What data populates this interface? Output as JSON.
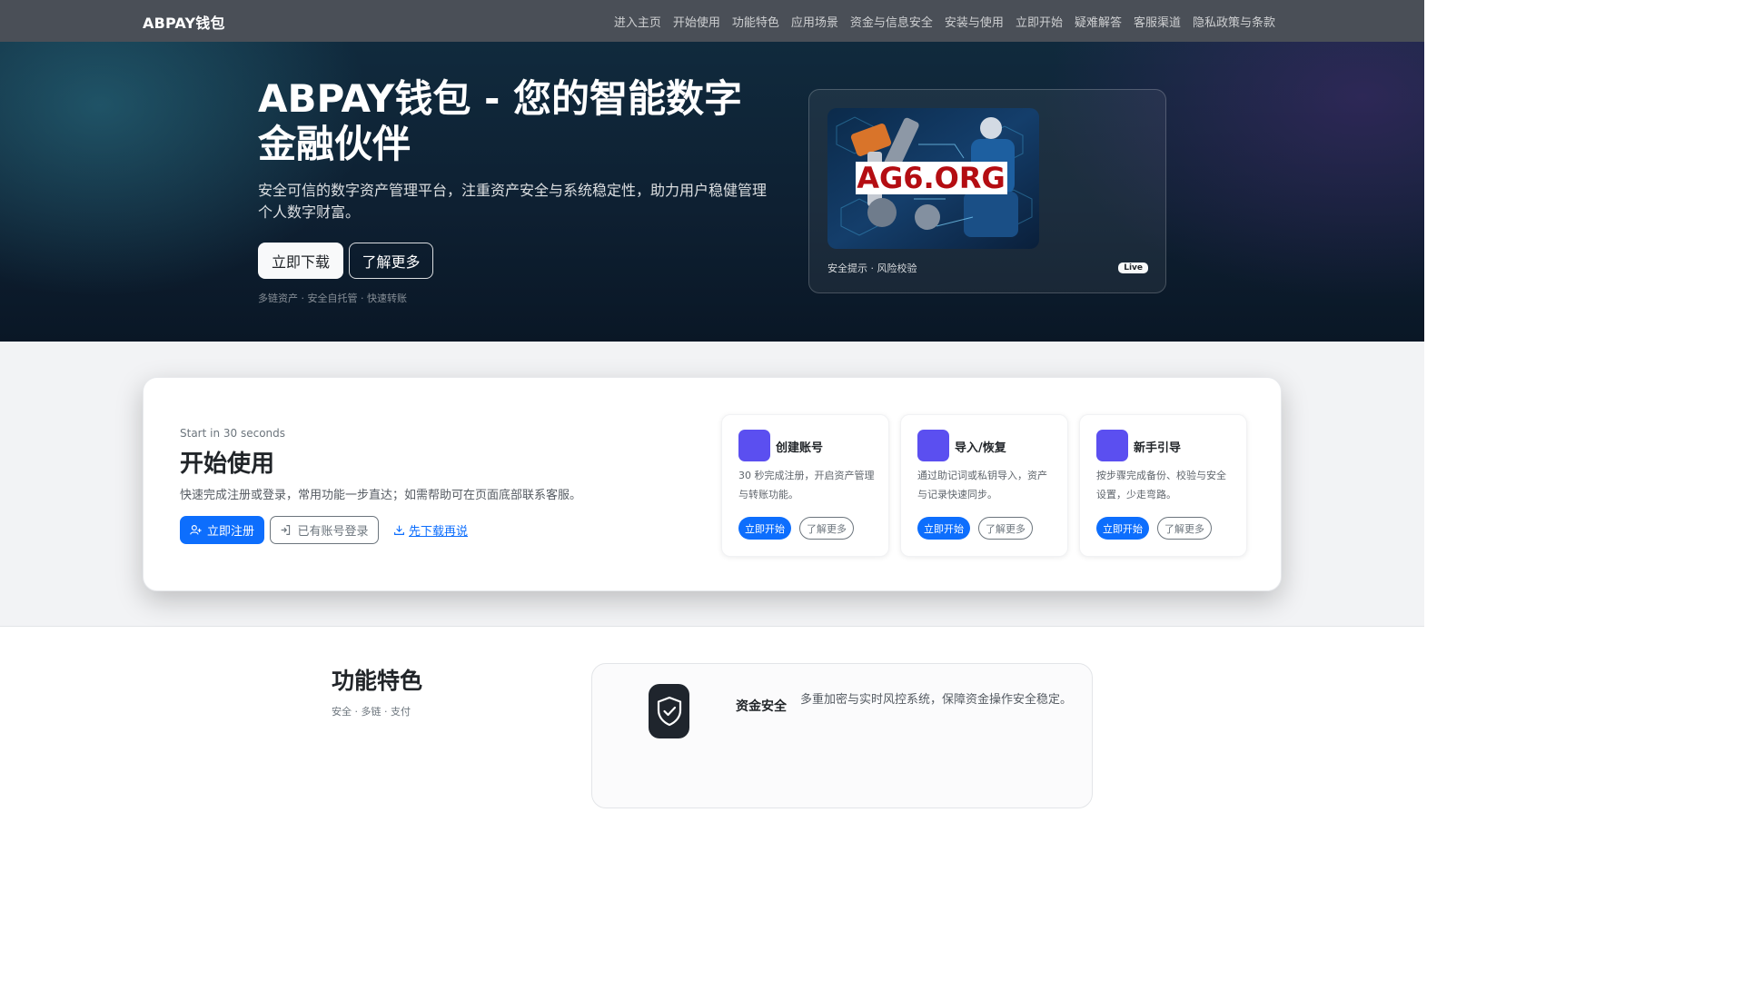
{
  "brand": "ABPAY钱包",
  "nav": [
    "进入主页",
    "开始使用",
    "功能特色",
    "应用场景",
    "资金与信息安全",
    "安装与使用",
    "立即开始",
    "疑难解答",
    "客服渠道",
    "隐私政策与条款"
  ],
  "hero": {
    "title": "ABPAY钱包 - 您的智能数字金融伙伴",
    "lead": "安全可信的数字资产管理平台，注重资产安全与系统稳定性，助力用户稳健管理个人数字财富。",
    "download_label": "立即下载",
    "learn_label": "了解更多",
    "tags": "多链资产 · 安全自托管 · 快速转账",
    "card": {
      "image_text": "AG6.ORG",
      "caption": "安全提示 · 风险校验",
      "badge": "Live"
    }
  },
  "start": {
    "eyebrow": "Start in 30 seconds",
    "title": "开始使用",
    "desc": "快速完成注册或登录，常用功能一步直达；如需帮助可在页面底部联系客服。",
    "register_label": "立即注册",
    "login_label": "已有账号登录",
    "later_label": "先下载再说",
    "cards": [
      {
        "title": "创建账号",
        "desc": "30 秒完成注册，开启资产管理与转账功能。",
        "start_label": "立即开始",
        "more_label": "了解更多"
      },
      {
        "title": "导入/恢复",
        "desc": "通过助记词或私钥导入，资产与记录快速同步。",
        "start_label": "立即开始",
        "more_label": "了解更多"
      },
      {
        "title": "新手引导",
        "desc": "按步骤完成备份、校验与安全设置，少走弯路。",
        "start_label": "立即开始",
        "more_label": "了解更多"
      }
    ]
  },
  "features": {
    "title": "功能特色",
    "subtitle": "安全 · 多链 · 支付",
    "items": [
      {
        "name": "资金安全",
        "desc": "多重加密与实时风控系统，保障资金操作安全稳定。",
        "icon": "shield-check-icon"
      }
    ]
  },
  "colors": {
    "primary": "#0d6efd",
    "accent_icon": "#5b4ff0",
    "navbar": "#4a4f57",
    "hero_bg": "#0e2032"
  }
}
